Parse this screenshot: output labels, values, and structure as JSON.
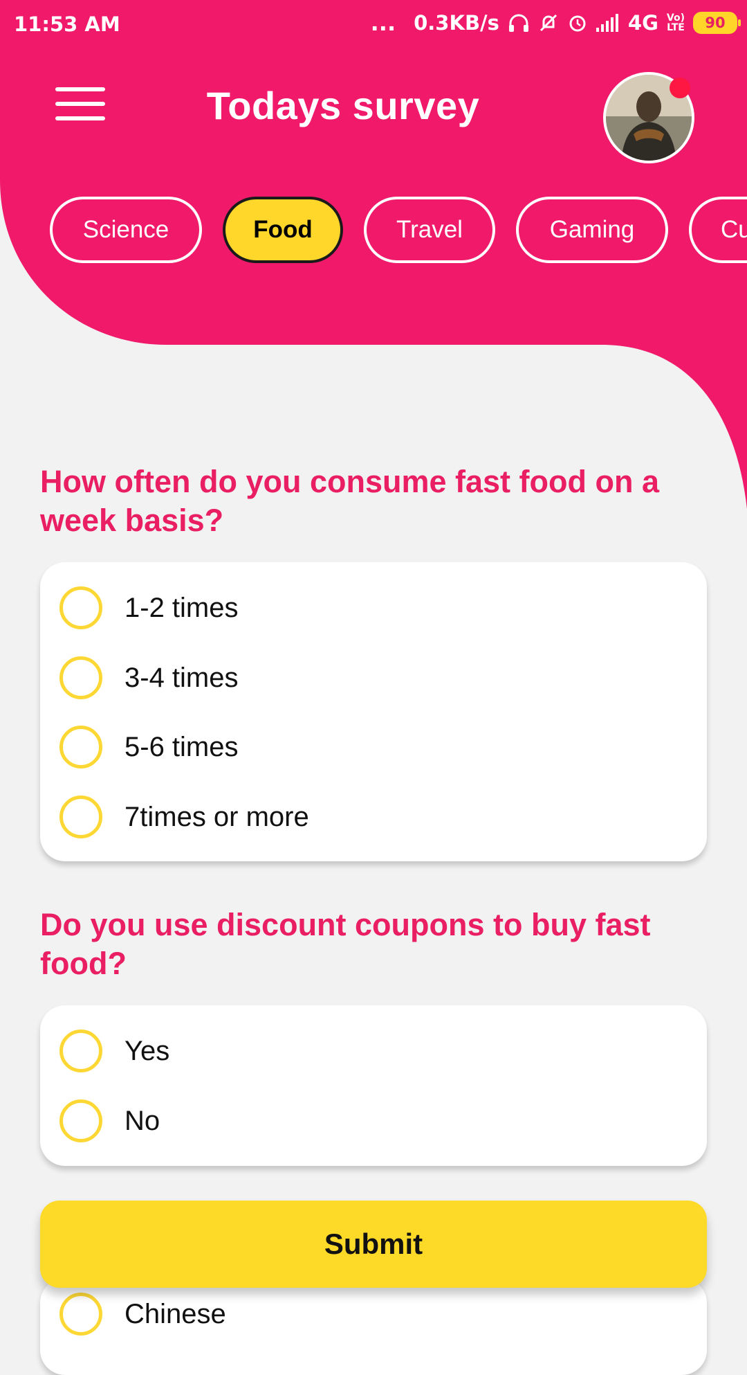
{
  "status_bar": {
    "time": "11:53 AM",
    "dots": "...",
    "speed": "0.3KB/s",
    "network": "4G",
    "volte_line1": "Vo)",
    "volte_line2": "LTE",
    "battery": "90",
    "icons": [
      "headphones-icon",
      "notifications-off-icon",
      "alarm-icon",
      "signal-icon"
    ]
  },
  "header": {
    "title": "Todays survey",
    "menu_icon": "hamburger-menu-icon",
    "avatar_alt": "profile photo"
  },
  "categories": [
    {
      "label": "Science",
      "active": false
    },
    {
      "label": "Food",
      "active": true
    },
    {
      "label": "Travel",
      "active": false
    },
    {
      "label": "Gaming",
      "active": false
    },
    {
      "label": "Cu",
      "active": false
    }
  ],
  "questions": [
    {
      "text": "How often do you consume fast food on a week basis?",
      "options": [
        "1-2 times",
        "3-4 times",
        "5-6 times",
        "7times or more"
      ]
    },
    {
      "text": "Do you use discount coupons to buy fast food?",
      "options": [
        "Yes",
        "No"
      ]
    }
  ],
  "partial_option": "Chinese",
  "submit_label": "Submit",
  "colors": {
    "primary": "#f0196a",
    "accent": "#fdd835",
    "background": "#f2f2f2"
  }
}
